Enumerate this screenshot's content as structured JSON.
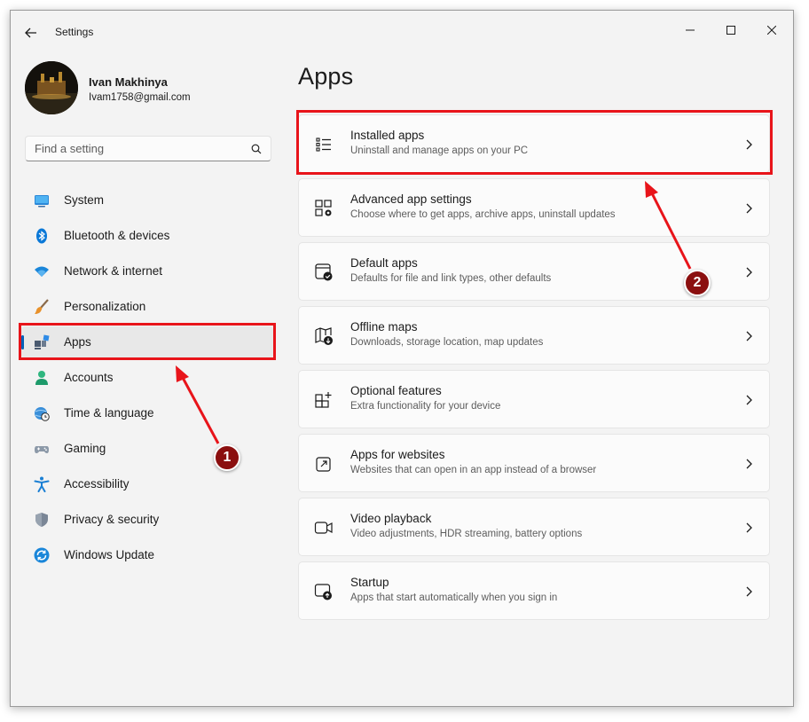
{
  "window": {
    "title": "Settings"
  },
  "profile": {
    "name": "Ivan Makhinya",
    "email": "Ivam1758@gmail.com"
  },
  "search": {
    "placeholder": "Find a setting"
  },
  "nav": {
    "items": [
      {
        "label": "System",
        "icon": "system-monitor-icon"
      },
      {
        "label": "Bluetooth & devices",
        "icon": "bluetooth-icon"
      },
      {
        "label": "Network & internet",
        "icon": "wifi-icon"
      },
      {
        "label": "Personalization",
        "icon": "paintbrush-icon"
      },
      {
        "label": "Apps",
        "icon": "apps-icon",
        "selected": true
      },
      {
        "label": "Accounts",
        "icon": "person-icon"
      },
      {
        "label": "Time & language",
        "icon": "globe-clock-icon"
      },
      {
        "label": "Gaming",
        "icon": "gamepad-icon"
      },
      {
        "label": "Accessibility",
        "icon": "accessibility-icon"
      },
      {
        "label": "Privacy & security",
        "icon": "shield-icon"
      },
      {
        "label": "Windows Update",
        "icon": "update-icon"
      }
    ]
  },
  "main": {
    "title": "Apps",
    "cards": [
      {
        "title": "Installed apps",
        "description": "Uninstall and manage apps on your PC",
        "icon": "list-icon"
      },
      {
        "title": "Advanced app settings",
        "description": "Choose where to get apps, archive apps, uninstall updates",
        "icon": "app-settings-icon"
      },
      {
        "title": "Default apps",
        "description": "Defaults for file and link types, other defaults",
        "icon": "default-apps-icon"
      },
      {
        "title": "Offline maps",
        "description": "Downloads, storage location, map updates",
        "icon": "map-download-icon"
      },
      {
        "title": "Optional features",
        "description": "Extra functionality for your device",
        "icon": "add-grid-icon"
      },
      {
        "title": "Apps for websites",
        "description": "Websites that can open in an app instead of a browser",
        "icon": "open-in-app-icon"
      },
      {
        "title": "Video playback",
        "description": "Video adjustments, HDR streaming, battery options",
        "icon": "video-camera-icon"
      },
      {
        "title": "Startup",
        "description": "Apps that start automatically when you sign in",
        "icon": "startup-icon"
      }
    ]
  },
  "annotations": {
    "step1": "1",
    "step2": "2",
    "color": "#e8141a",
    "badge_color": "#8b0f0f"
  },
  "colors": {
    "accent": "#005fb8",
    "window_bg": "#f3f3f3",
    "card_bg": "#fbfbfb"
  }
}
